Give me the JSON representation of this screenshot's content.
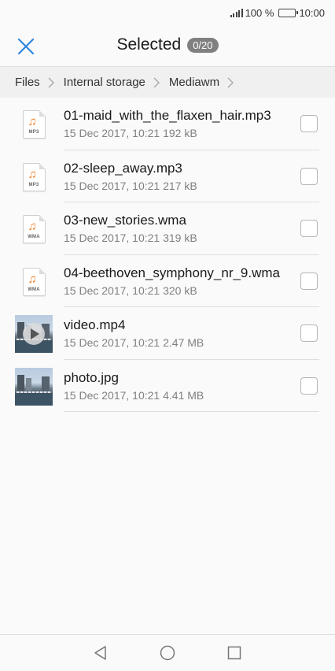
{
  "status_bar": {
    "battery_percent": "100 %",
    "time": "10:00"
  },
  "header": {
    "title": "Selected",
    "selection_count": "0/20",
    "close_icon": "close-icon",
    "accent_color": "#2e86de"
  },
  "breadcrumb": {
    "items": [
      "Files",
      "Internal storage",
      "Mediawm"
    ]
  },
  "files": [
    {
      "name": "01-maid_with_the_flaxen_hair.mp3",
      "date": "15 Dec 2017, 10:21",
      "size": "192 kB",
      "type": "audio",
      "ext": "MP3",
      "checked": false
    },
    {
      "name": "02-sleep_away.mp3",
      "date": "15 Dec 2017, 10:21",
      "size": "217 kB",
      "type": "audio",
      "ext": "MP3",
      "checked": false
    },
    {
      "name": "03-new_stories.wma",
      "date": "15 Dec 2017, 10:21",
      "size": "319 kB",
      "type": "audio",
      "ext": "WMA",
      "checked": false
    },
    {
      "name": "04-beethoven_symphony_nr_9.wma",
      "date": "15 Dec 2017, 10:21",
      "size": "320 kB",
      "type": "audio",
      "ext": "WMA",
      "checked": false
    },
    {
      "name": "video.mp4",
      "date": "15 Dec 2017, 10:21",
      "size": "2.47 MB",
      "type": "video",
      "ext": "",
      "checked": false
    },
    {
      "name": "photo.jpg",
      "date": "15 Dec 2017, 10:21",
      "size": "4.41 MB",
      "type": "image",
      "ext": "",
      "checked": false
    }
  ],
  "nav_bar": {
    "back_icon": "back-triangle-icon",
    "home_icon": "home-circle-icon",
    "recents_icon": "recents-square-icon"
  }
}
